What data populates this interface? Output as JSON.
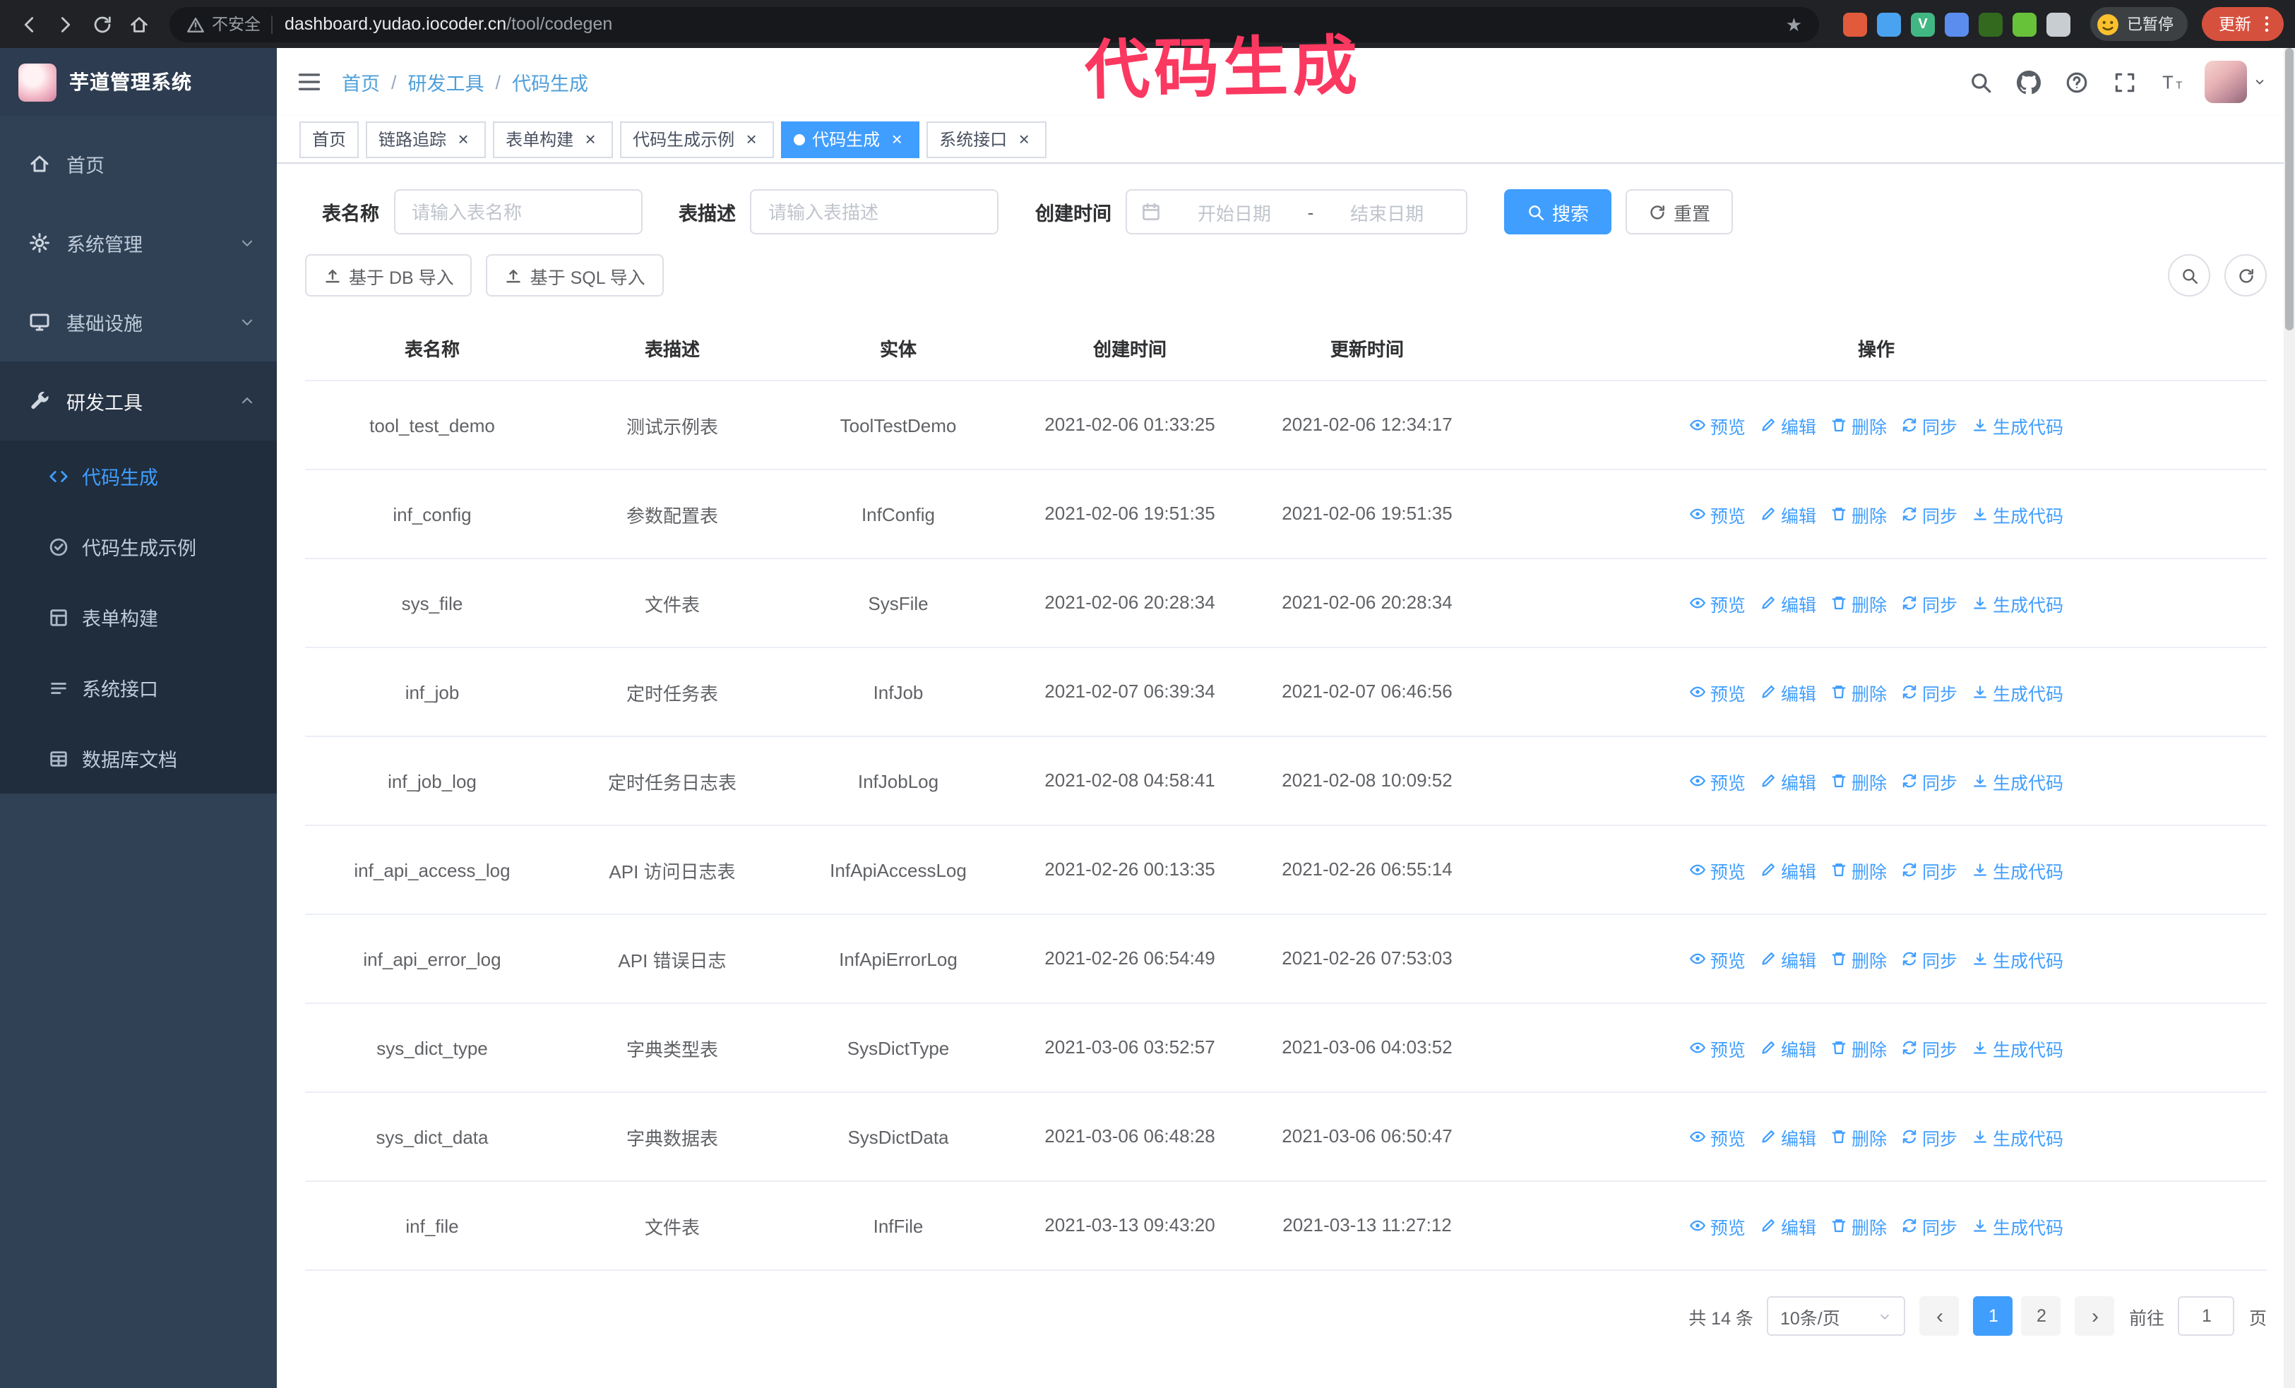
{
  "annotation": {
    "text": "代码生成",
    "color": "#fb3860"
  },
  "browser": {
    "security_label": "不安全",
    "url_domain": "dashboard.yudao.iocoder.cn",
    "url_path": "/tool/codegen",
    "profile_label": "已暂停",
    "update_label": "更新",
    "extensions": [
      {
        "color": "#e25a3c",
        "glyph": ""
      },
      {
        "color": "#4aa3f0",
        "glyph": ""
      },
      {
        "color": "#41b883",
        "glyph": "V"
      },
      {
        "color": "#5b8def",
        "glyph": ""
      },
      {
        "color": "#33691e",
        "glyph": ""
      },
      {
        "color": "#67c23a",
        "glyph": ""
      },
      {
        "color": "#c8cdd2",
        "glyph": ""
      }
    ]
  },
  "sidebar": {
    "logo_title": "芋道管理系统",
    "items": [
      {
        "label": "首页",
        "icon": "home-icon"
      },
      {
        "label": "系统管理",
        "icon": "gear-icon",
        "chevron": "down"
      },
      {
        "label": "基础设施",
        "icon": "infrastructure-icon",
        "chevron": "down"
      },
      {
        "label": "研发工具",
        "icon": "tools-icon",
        "chevron": "up",
        "active": true
      }
    ],
    "submenu": [
      {
        "label": "代码生成",
        "icon": "code-icon",
        "active": true
      },
      {
        "label": "代码生成示例",
        "icon": "example-icon"
      },
      {
        "label": "表单构建",
        "icon": "form-icon"
      },
      {
        "label": "系统接口",
        "icon": "api-icon"
      },
      {
        "label": "数据库文档",
        "icon": "database-icon"
      }
    ]
  },
  "header": {
    "breadcrumb": [
      "首页",
      "研发工具",
      "代码生成"
    ],
    "icons": [
      "search-icon",
      "github-icon",
      "question-icon",
      "fullscreen-icon",
      "font-size-icon"
    ]
  },
  "tabs": [
    {
      "label": "首页",
      "closable": false,
      "active": false
    },
    {
      "label": "链路追踪",
      "closable": true,
      "active": false
    },
    {
      "label": "表单构建",
      "closable": true,
      "active": false
    },
    {
      "label": "代码生成示例",
      "closable": true,
      "active": false
    },
    {
      "label": "代码生成",
      "closable": true,
      "active": true
    },
    {
      "label": "系统接口",
      "closable": true,
      "active": false
    }
  ],
  "filters": {
    "table_name_label": "表名称",
    "table_name_placeholder": "请输入表名称",
    "table_desc_label": "表描述",
    "table_desc_placeholder": "请输入表描述",
    "create_time_label": "创建时间",
    "date_start_placeholder": "开始日期",
    "date_separator": "-",
    "date_end_placeholder": "结束日期",
    "search_button": "搜索",
    "reset_button": "重置"
  },
  "toolbar": {
    "import_db_button": "基于 DB 导入",
    "import_sql_button": "基于 SQL 导入"
  },
  "table": {
    "columns": [
      "表名称",
      "表描述",
      "实体",
      "创建时间",
      "更新时间",
      "操作"
    ],
    "actions": [
      {
        "label": "预览",
        "name": "preview-action",
        "icon": "eye-icon"
      },
      {
        "label": "编辑",
        "name": "edit-action",
        "icon": "edit-icon"
      },
      {
        "label": "删除",
        "name": "delete-action",
        "icon": "delete-icon"
      },
      {
        "label": "同步",
        "name": "sync-action",
        "icon": "sync-icon"
      },
      {
        "label": "生成代码",
        "name": "generate-code-action",
        "icon": "download-icon"
      }
    ],
    "rows": [
      {
        "name": "tool_test_demo",
        "desc": "测试示例表",
        "entity": "ToolTestDemo",
        "created": "2021-02-06 01:33:25",
        "updated": "2021-02-06 12:34:17"
      },
      {
        "name": "inf_config",
        "desc": "参数配置表",
        "entity": "InfConfig",
        "created": "2021-02-06 19:51:35",
        "updated": "2021-02-06 19:51:35"
      },
      {
        "name": "sys_file",
        "desc": "文件表",
        "entity": "SysFile",
        "created": "2021-02-06 20:28:34",
        "updated": "2021-02-06 20:28:34"
      },
      {
        "name": "inf_job",
        "desc": "定时任务表",
        "entity": "InfJob",
        "created": "2021-02-07 06:39:34",
        "updated": "2021-02-07 06:46:56"
      },
      {
        "name": "inf_job_log",
        "desc": "定时任务日志表",
        "entity": "InfJobLog",
        "created": "2021-02-08 04:58:41",
        "updated": "2021-02-08 10:09:52"
      },
      {
        "name": "inf_api_access_log",
        "desc": "API 访问日志表",
        "entity": "InfApiAccessLog",
        "created": "2021-02-26 00:13:35",
        "updated": "2021-02-26 06:55:14"
      },
      {
        "name": "inf_api_error_log",
        "desc": "API 错误日志",
        "entity": "InfApiErrorLog",
        "created": "2021-02-26 06:54:49",
        "updated": "2021-02-26 07:53:03"
      },
      {
        "name": "sys_dict_type",
        "desc": "字典类型表",
        "entity": "SysDictType",
        "created": "2021-03-06 03:52:57",
        "updated": "2021-03-06 04:03:52"
      },
      {
        "name": "sys_dict_data",
        "desc": "字典数据表",
        "entity": "SysDictData",
        "created": "2021-03-06 06:48:28",
        "updated": "2021-03-06 06:50:47"
      },
      {
        "name": "inf_file",
        "desc": "文件表",
        "entity": "InfFile",
        "created": "2021-03-13 09:43:20",
        "updated": "2021-03-13 11:27:12"
      }
    ]
  },
  "pagination": {
    "total": "共 14 条",
    "page_size": "10条/页",
    "prev": "‹",
    "next": "›",
    "pages": [
      {
        "label": "1",
        "active": true
      },
      {
        "label": "2",
        "active": false
      }
    ],
    "goto_label": "前往",
    "goto_value": "1",
    "goto_suffix": "页"
  }
}
